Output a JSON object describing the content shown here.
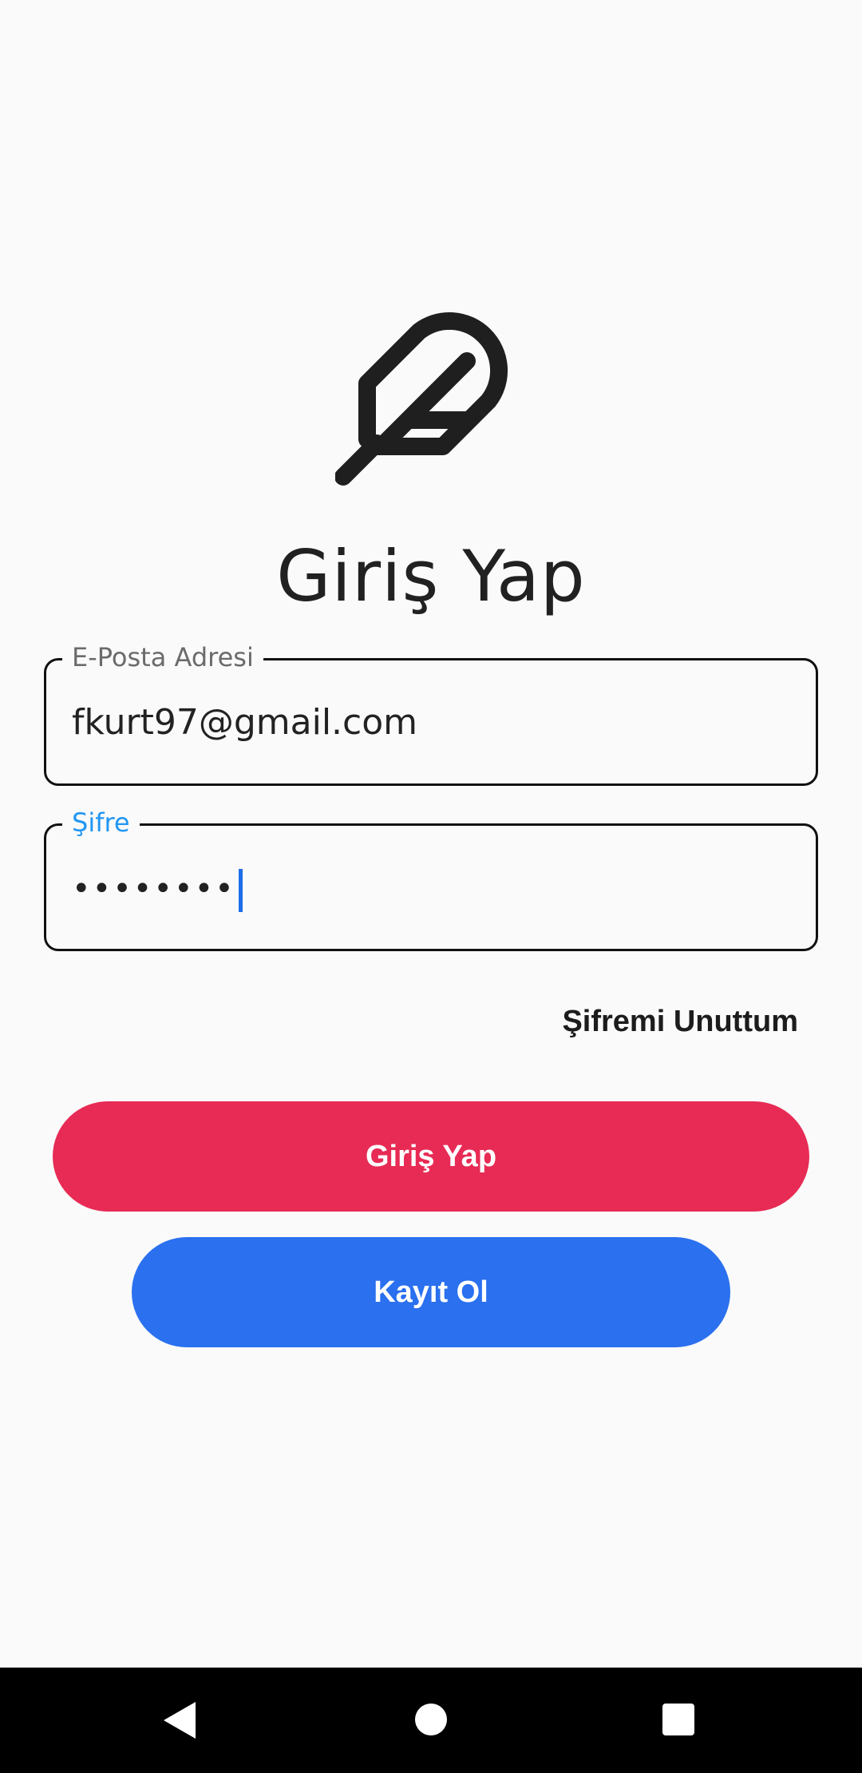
{
  "title": "Giriş Yap",
  "email_field": {
    "label": "E-Posta Adresi",
    "value": "fkurt97@gmail.com"
  },
  "password_field": {
    "label": "Şifre",
    "value": "••••••••"
  },
  "forgot_label": "Şifremi Unuttum",
  "login_button_label": "Giriş Yap",
  "register_button_label": "Kayıt Ol",
  "colors": {
    "login_button": "#e72b55",
    "register_button": "#2a70ef",
    "focused_label": "#2196f3"
  },
  "icons": {
    "logo": "feather-icon",
    "nav_back": "back-triangle-icon",
    "nav_home": "home-circle-icon",
    "nav_recents": "recents-square-icon"
  }
}
